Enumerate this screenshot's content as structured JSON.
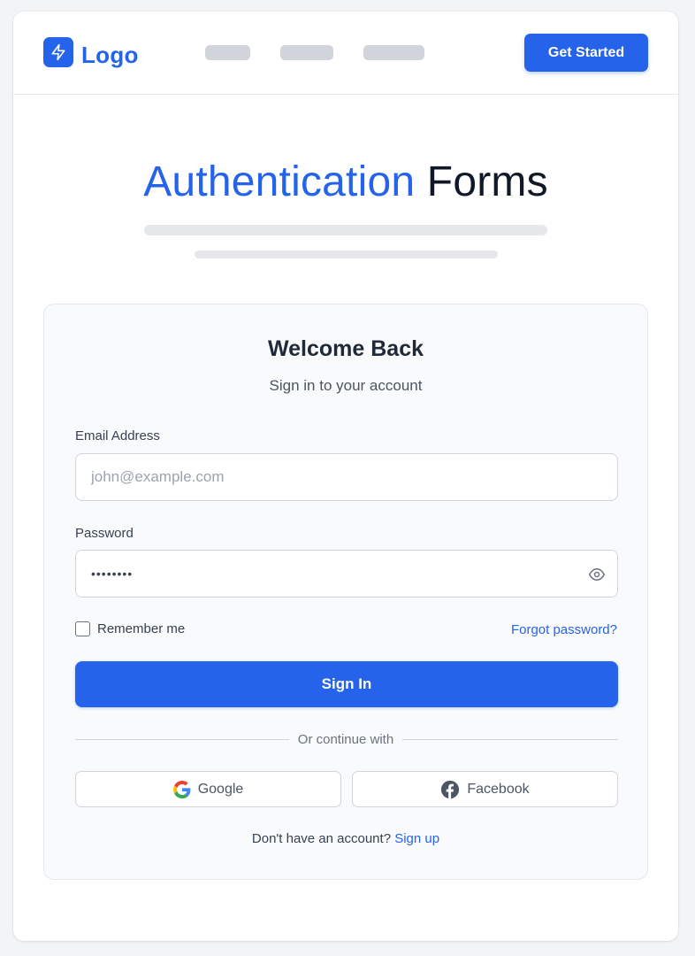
{
  "colors": {
    "accent": "#2563eb",
    "text": "#1f2937",
    "muted": "#4b5563"
  },
  "nav": {
    "logo_icon": "lightning-bolt-icon",
    "logo_text": "Logo",
    "cta_label": "Get Started"
  },
  "hero": {
    "title_highlight": "Authentication",
    "title_rest": "Forms"
  },
  "form": {
    "title": "Welcome Back",
    "subtitle": "Sign in to your account",
    "email_label": "Email Address",
    "email_placeholder": "john@example.com",
    "password_label": "Password",
    "password_value": "••••••••",
    "password_toggle_icon": "eye-icon",
    "remember_label": "Remember me",
    "forgot_label": "Forgot password?",
    "submit_label": "Sign In",
    "divider_text": "Or continue with",
    "google_label": "Google",
    "facebook_label": "Facebook",
    "signup_prompt": "Don't have an account?",
    "signup_link": "Sign up"
  }
}
